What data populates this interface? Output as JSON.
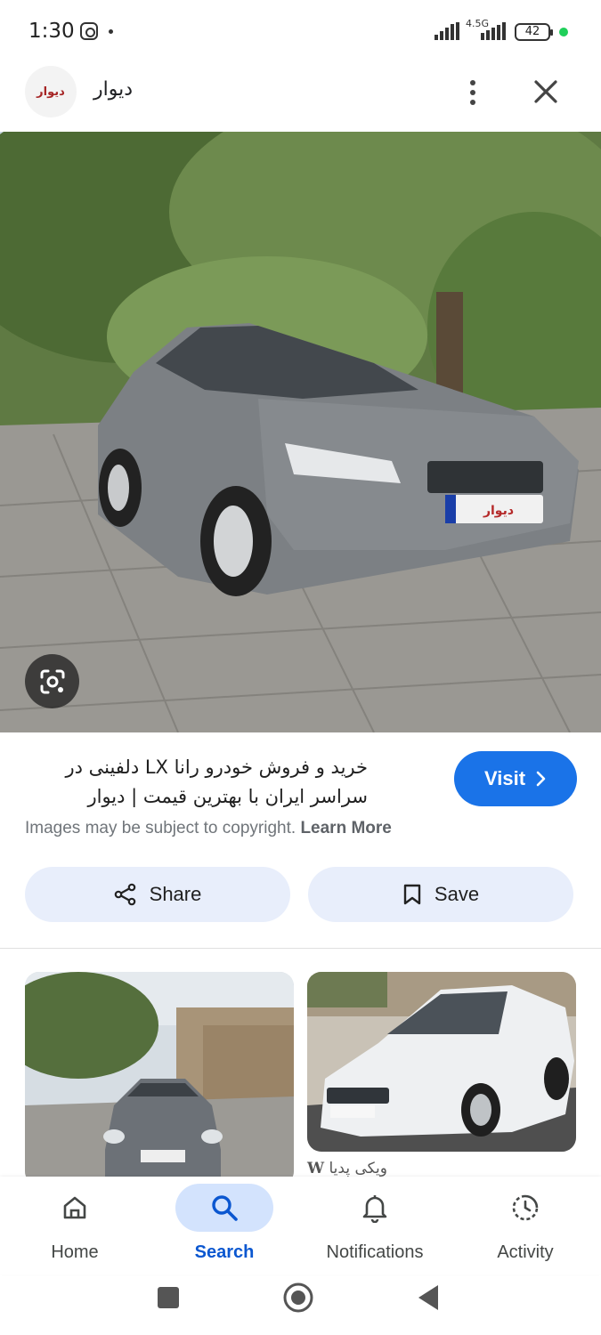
{
  "status_bar": {
    "time": "1:30",
    "network": "4.5G",
    "battery": "42",
    "icons": [
      "instagram-icon",
      "signal-icon",
      "battery-icon"
    ]
  },
  "header": {
    "logo_text": "دیوار",
    "site_name": "دیوار",
    "icons": [
      "more-vert-icon",
      "close-icon"
    ]
  },
  "result": {
    "title": "خرید و فروش خودرو رانا LX دلفینی در سراسر ایران با بهترین قیمت | دیوار",
    "visit_label": "Visit",
    "copyright_text": "Images may be subject to copyright.",
    "learn_more_label": "Learn More",
    "share_label": "Share",
    "save_label": "Save",
    "plate_logo_text": "دیوار"
  },
  "related": {
    "second_source": "ویکی پدیا",
    "second_source_icon": "W"
  },
  "bottom_nav": {
    "items": [
      {
        "label": "Home",
        "icon": "home-icon"
      },
      {
        "label": "Search",
        "icon": "search-icon"
      },
      {
        "label": "Notifications",
        "icon": "bell-icon"
      },
      {
        "label": "Activity",
        "icon": "activity-icon"
      }
    ],
    "active": "Search"
  },
  "colors": {
    "accent": "#1a73e8",
    "button_bg": "#e8eefb",
    "active_nav_bg": "#d3e3fd",
    "active_nav_text": "#0b57d0"
  }
}
